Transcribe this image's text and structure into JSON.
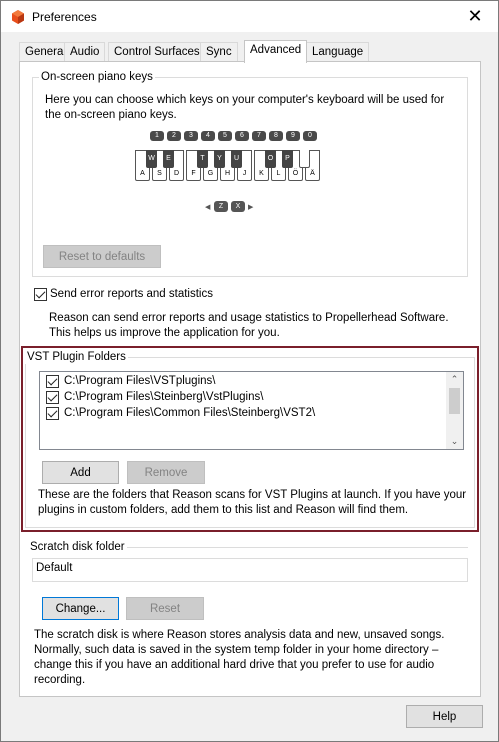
{
  "window": {
    "title": "Preferences",
    "close_glyph": "✕"
  },
  "tabs": [
    "General",
    "Audio",
    "Control Surfaces",
    "Sync",
    "Advanced",
    "Language"
  ],
  "piano": {
    "group_label": "On-screen piano keys",
    "description": "Here you can choose which keys on your computer's keyboard will be used for the on-screen piano keys.",
    "numbers": [
      "1",
      "2",
      "3",
      "4",
      "5",
      "6",
      "7",
      "8",
      "9",
      "0"
    ],
    "black_keys": [
      "W",
      "E",
      "",
      "T",
      "Y",
      "U",
      "",
      "O",
      "P",
      ""
    ],
    "white_keys": [
      "A",
      "S",
      "D",
      "F",
      "G",
      "H",
      "J",
      "K",
      "L",
      "Ö",
      "Ä"
    ],
    "octave_keys": [
      "Z",
      "X"
    ],
    "reset_label": "Reset to defaults"
  },
  "error_reports": {
    "checkbox_label": "Send error reports and statistics",
    "checked": true,
    "description": "Reason can send error reports and usage statistics to Propellerhead Software. This helps us improve the application for you."
  },
  "vst": {
    "group_label": "VST Plugin Folders",
    "folders": [
      {
        "path": "C:\\Program Files\\VSTplugins\\",
        "checked": true
      },
      {
        "path": "C:\\Program Files\\Steinberg\\VstPlugins\\",
        "checked": true
      },
      {
        "path": "C:\\Program Files\\Common Files\\Steinberg\\VST2\\",
        "checked": true
      }
    ],
    "add_label": "Add",
    "remove_label": "Remove",
    "description": "These are the folders that Reason scans for VST Plugins at launch. If you have your plugins in custom folders, add them to this list and Reason will find them."
  },
  "scratch": {
    "group_label": "Scratch disk folder",
    "value": "Default",
    "change_label": "Change...",
    "reset_label": "Reset",
    "description": "The scratch disk is where Reason stores analysis data and new, unsaved songs. Normally, such data is saved in the system temp folder in your home directory – change this if you have an additional hard drive that you prefer to use for audio recording."
  },
  "help_label": "Help",
  "colors": {
    "accent": "#0078d7",
    "highlight_border": "#7a1f2b",
    "app_icon": "#e84e1b"
  }
}
